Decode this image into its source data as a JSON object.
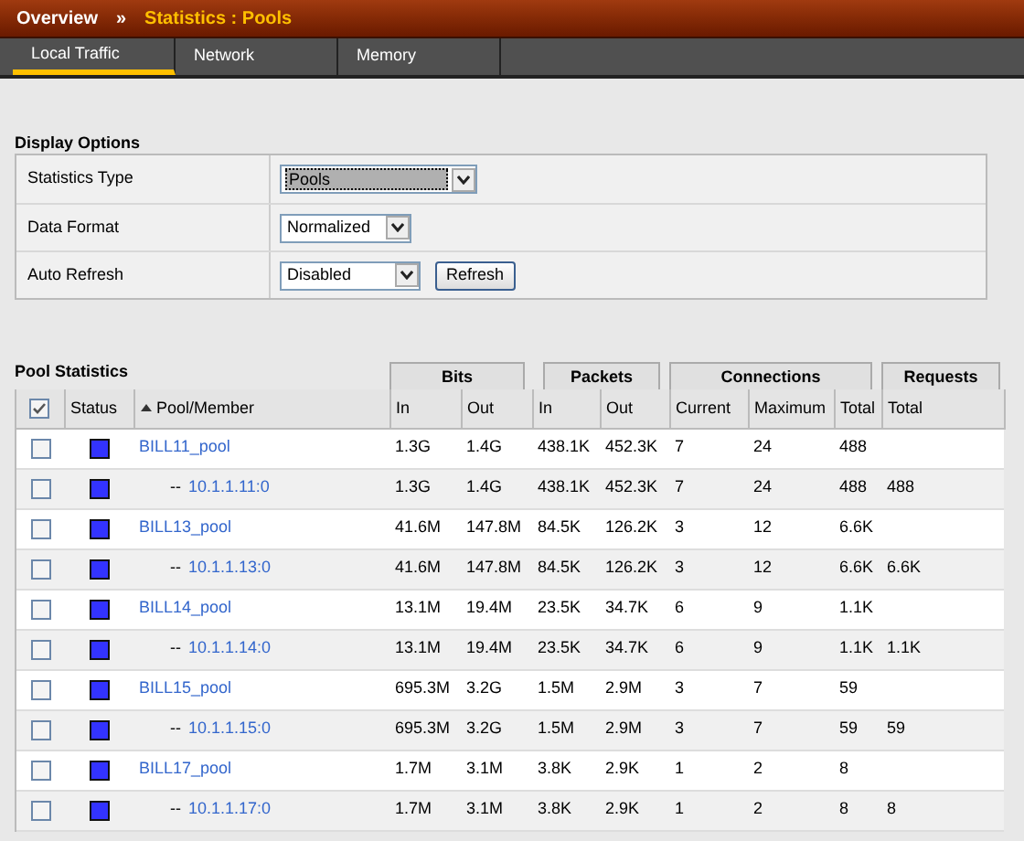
{
  "breadcrumb": {
    "root": "Overview",
    "separator": "»",
    "current": "Statistics : Pools"
  },
  "tabs": [
    {
      "label": "Local Traffic",
      "selected": true
    },
    {
      "label": "Network",
      "selected": false
    },
    {
      "label": "Memory",
      "selected": false
    }
  ],
  "display_options": {
    "title": "Display Options",
    "rows": [
      {
        "label": "Statistics Type",
        "value": "Pools",
        "focused": true
      },
      {
        "label": "Data Format",
        "value": "Normalized",
        "focused": false
      },
      {
        "label": "Auto Refresh",
        "value": "Disabled",
        "focused": false,
        "button": "Refresh"
      }
    ]
  },
  "pool_statistics": {
    "title": "Pool Statistics",
    "groups": [
      "Bits",
      "Packets",
      "Connections",
      "Requests"
    ],
    "select_all_checked": true,
    "columns": [
      "Status",
      "Pool/Member",
      "In",
      "Out",
      "In",
      "Out",
      "Current",
      "Maximum",
      "Total",
      "Total"
    ],
    "rows": [
      {
        "kind": "pool",
        "checked": false,
        "name": "BILL11_pool",
        "values": [
          "1.3G",
          "1.4G",
          "438.1K",
          "452.3K",
          "7",
          "24",
          "488"
        ]
      },
      {
        "kind": "member",
        "checked": false,
        "prefix": "--",
        "name": "10.1.1.11:0",
        "values": [
          "1.3G",
          "1.4G",
          "438.1K",
          "452.3K",
          "7",
          "24",
          "488",
          "488"
        ]
      },
      {
        "kind": "pool",
        "checked": false,
        "name": "BILL13_pool",
        "values": [
          "41.6M",
          "147.8M",
          "84.5K",
          "126.2K",
          "3",
          "12",
          "6.6K"
        ]
      },
      {
        "kind": "member",
        "checked": false,
        "prefix": "--",
        "name": "10.1.1.13:0",
        "values": [
          "41.6M",
          "147.8M",
          "84.5K",
          "126.2K",
          "3",
          "12",
          "6.6K",
          "6.6K"
        ]
      },
      {
        "kind": "pool",
        "checked": false,
        "name": "BILL14_pool",
        "values": [
          "13.1M",
          "19.4M",
          "23.5K",
          "34.7K",
          "6",
          "9",
          "1.1K"
        ]
      },
      {
        "kind": "member",
        "checked": false,
        "prefix": "--",
        "name": "10.1.1.14:0",
        "values": [
          "13.1M",
          "19.4M",
          "23.5K",
          "34.7K",
          "6",
          "9",
          "1.1K",
          "1.1K"
        ]
      },
      {
        "kind": "pool",
        "checked": false,
        "name": "BILL15_pool",
        "values": [
          "695.3M",
          "3.2G",
          "1.5M",
          "2.9M",
          "3",
          "7",
          "59"
        ]
      },
      {
        "kind": "member",
        "checked": false,
        "prefix": "--",
        "name": "10.1.1.15:0",
        "values": [
          "695.3M",
          "3.2G",
          "1.5M",
          "2.9M",
          "3",
          "7",
          "59",
          "59"
        ]
      },
      {
        "kind": "pool",
        "checked": false,
        "name": "BILL17_pool",
        "values": [
          "1.7M",
          "3.1M",
          "3.8K",
          "2.9K",
          "1",
          "2",
          "8"
        ]
      },
      {
        "kind": "member",
        "checked": false,
        "prefix": "--",
        "name": "10.1.1.17:0",
        "values": [
          "1.7M",
          "3.1M",
          "3.8K",
          "2.9K",
          "1",
          "2",
          "8",
          "8"
        ]
      }
    ]
  }
}
